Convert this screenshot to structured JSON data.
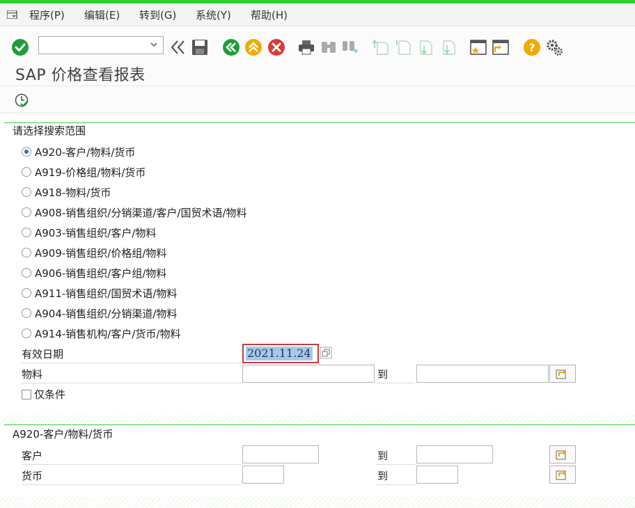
{
  "menu": {
    "items": [
      "程序(P)",
      "编辑(E)",
      "转到(G)",
      "系统(Y)",
      "帮助(H)"
    ]
  },
  "toolbar": {
    "command_value": "",
    "icons": [
      "enter-icon",
      "back-arrows-icon",
      "save-icon",
      "back-icon",
      "exit-icon",
      "cancel-icon",
      "print-icon",
      "find-icon",
      "find-next-icon",
      "first-page-icon",
      "previous-page-icon",
      "next-page-icon",
      "last-page-icon",
      "new-session-icon",
      "create-shortcut-icon",
      "help-icon",
      "settings-icon"
    ]
  },
  "page": {
    "title": "SAP 价格查看报表"
  },
  "app_toolbar": {
    "icons": [
      "execute-icon"
    ]
  },
  "search_group": {
    "title": "请选择搜索范围",
    "options": [
      "A920-客户/物料/货币",
      "A919-价格组/物料/货币",
      "A918-物料/货币",
      "A908-销售组织/分销渠道/客户/国贸术语/物料",
      "A903-销售组织/客户/物料",
      "A909-销售组织/价格组/物料",
      "A906-销售组织/客户组/物料",
      "A911-销售组织/国贸术语/物料",
      "A904-销售组织/分销渠道/物料",
      "A914-销售机构/客户/货币/物料"
    ],
    "selected_index": 0,
    "valid_date_label": "有效日期",
    "valid_date_value": "2021.11.24",
    "material_label": "物料",
    "material_from": "",
    "to_label": "到",
    "material_to": "",
    "condition_only_label": "仅条件",
    "condition_only_checked": false
  },
  "condition_group": {
    "title": "A920-客户/物料/货币",
    "customer_label": "客户",
    "customer_from": "",
    "customer_to": "",
    "currency_label": "货币",
    "currency_from": "",
    "currency_to": "",
    "to_label": "到"
  },
  "colors": {
    "accent_green": "#2ed12e",
    "ok_green": "#1f9d3a",
    "cancel_red": "#d93b3b",
    "help_orange": "#f2a900",
    "selection_blue": "#a9c7e8"
  }
}
